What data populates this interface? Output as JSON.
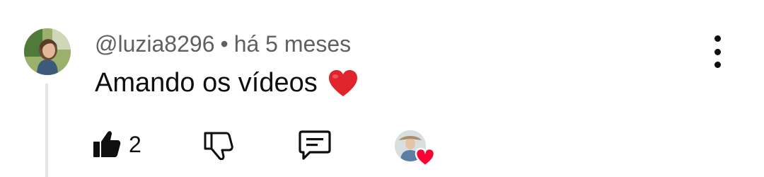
{
  "comment": {
    "author": "@luzia8296",
    "separator": "•",
    "timestamp": "há 5 meses",
    "text": "Amando os vídeos",
    "emoji": "heart"
  },
  "actions": {
    "like_count": "2",
    "like_icon": "thumbs-up-icon",
    "dislike_icon": "thumbs-down-icon",
    "reply_icon": "reply-icon",
    "more_icon": "more-vertical-icon"
  },
  "colors": {
    "text_primary": "#0f0f0f",
    "text_secondary": "#606060",
    "heart_red": "#ff0033",
    "emoji_red": "#e0242b",
    "thread_line": "#e5e5e5"
  }
}
